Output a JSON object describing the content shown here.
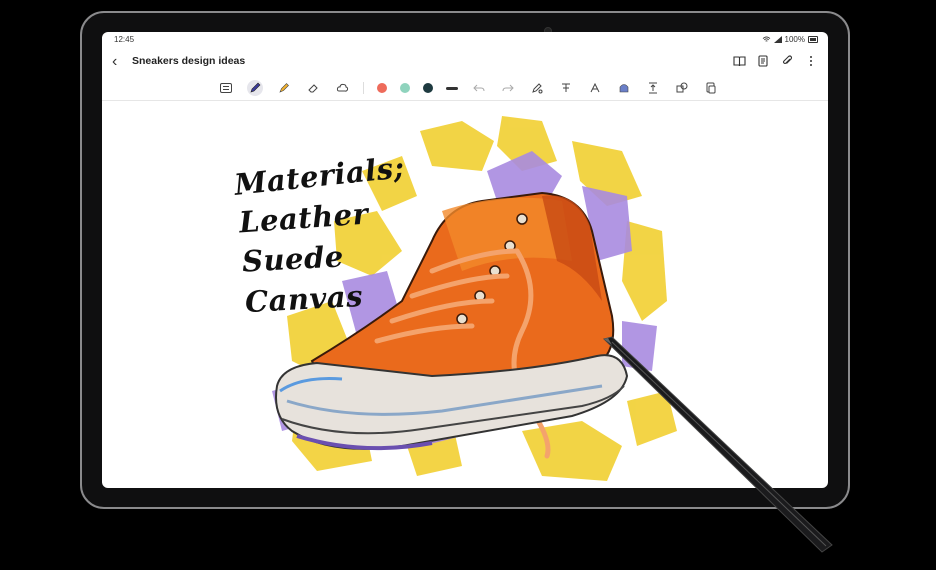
{
  "status": {
    "time": "12:45",
    "battery": "100%"
  },
  "header": {
    "title": "Sneakers design ideas"
  },
  "toolbar": {
    "colors": [
      "#ee6b5b",
      "#8fd3bd",
      "#1e3a40"
    ],
    "tools": [
      "keyboard-mode",
      "pen",
      "highlighter",
      "eraser",
      "lasso",
      "undo",
      "redo",
      "pen-settings",
      "text-style",
      "text-align",
      "shapes",
      "insert",
      "convert",
      "layers"
    ]
  },
  "note": {
    "handwriting": [
      "Materials;",
      "Leather",
      "Suede",
      "Canvas"
    ]
  }
}
